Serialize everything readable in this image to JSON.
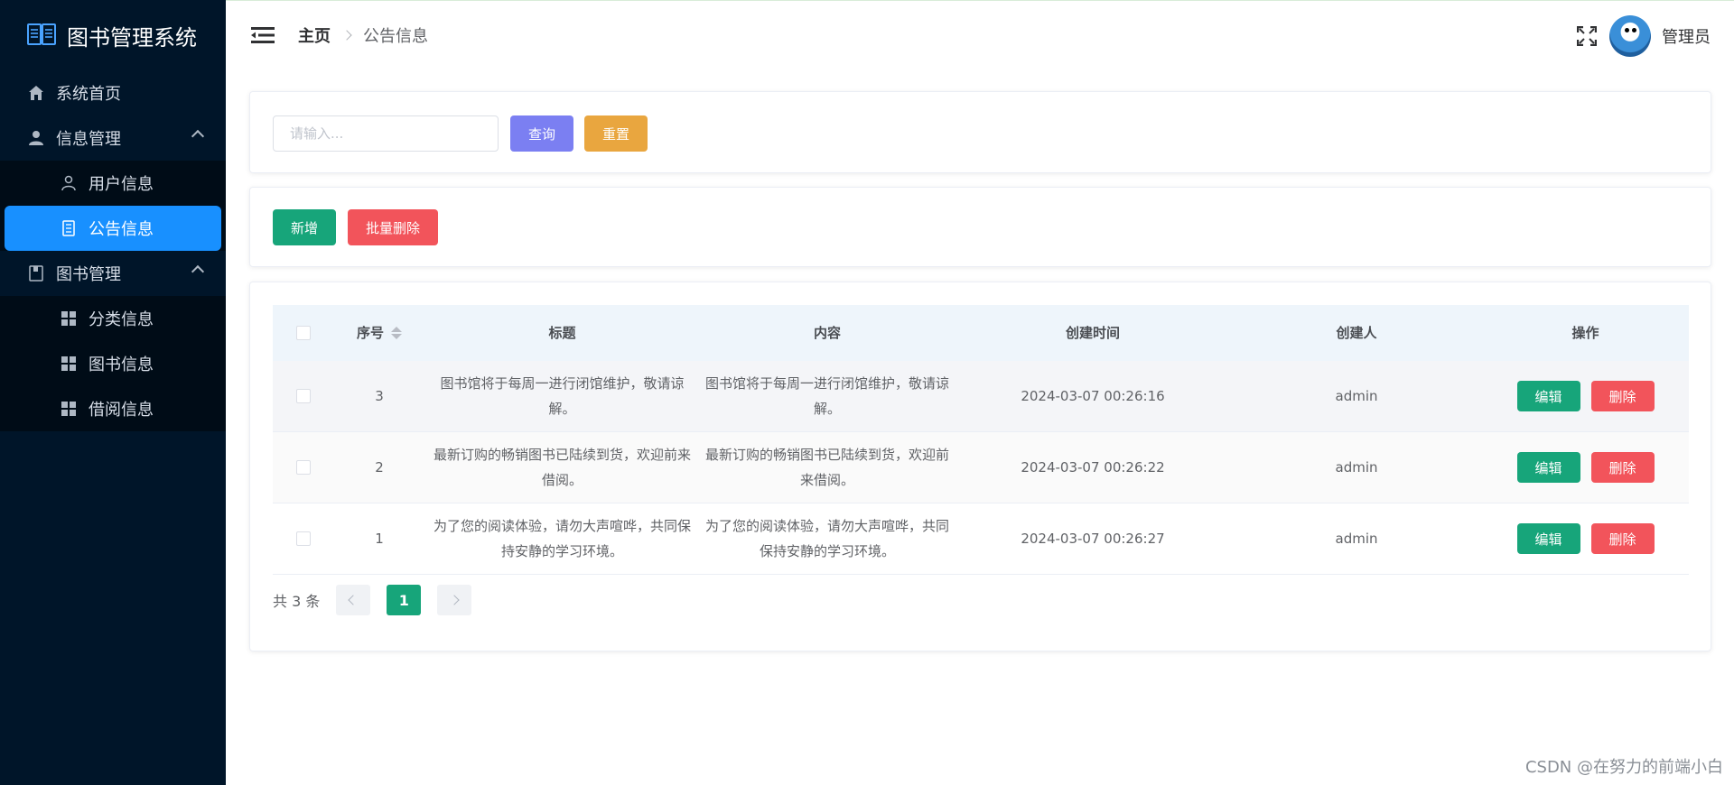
{
  "app": {
    "title": "图书管理系统"
  },
  "sidebar": {
    "items": [
      {
        "label": "系统首页"
      },
      {
        "label": "信息管理"
      },
      {
        "label": "用户信息"
      },
      {
        "label": "公告信息"
      },
      {
        "label": "图书管理"
      },
      {
        "label": "分类信息"
      },
      {
        "label": "图书信息"
      },
      {
        "label": "借阅信息"
      }
    ],
    "active_color": "#1890ff"
  },
  "header": {
    "breadcrumb_home": "主页",
    "breadcrumb_current": "公告信息",
    "username": "管理员"
  },
  "search": {
    "placeholder": "请输入...",
    "value": "",
    "query_label": "查询",
    "reset_label": "重置"
  },
  "toolbar": {
    "add_label": "新增",
    "batch_delete_label": "批量删除"
  },
  "table": {
    "headers": {
      "index": "序号",
      "title": "标题",
      "content": "内容",
      "created_time": "创建时间",
      "creator": "创建人",
      "actions": "操作"
    },
    "rows": [
      {
        "index": "3",
        "title": "图书馆将于每周一进行闭馆维护，敬请谅解。",
        "content": "图书馆将于每周一进行闭馆维护，敬请谅解。",
        "created_time": "2024-03-07 00:26:16",
        "creator": "admin",
        "edit_label": "编辑",
        "delete_label": "删除"
      },
      {
        "index": "2",
        "title": "最新订购的畅销图书已陆续到货，欢迎前来借阅。",
        "content": "最新订购的畅销图书已陆续到货，欢迎前来借阅。",
        "created_time": "2024-03-07 00:26:22",
        "creator": "admin",
        "edit_label": "编辑",
        "delete_label": "删除"
      },
      {
        "index": "1",
        "title": "为了您的阅读体验，请勿大声喧哗，共同保持安静的学习环境。",
        "content": "为了您的阅读体验，请勿大声喧哗，共同保持安静的学习环境。",
        "created_time": "2024-03-07 00:26:27",
        "creator": "admin",
        "edit_label": "编辑",
        "delete_label": "删除"
      }
    ]
  },
  "pagination": {
    "total_text": "共 3 条",
    "current_page": "1"
  },
  "watermark": "CSDN @在努力的前端小白",
  "colors": {
    "sidebar_bg": "#001529",
    "primary_green": "#17a57a",
    "danger_red": "#f2545b",
    "query_purple": "#7b7ff2",
    "reset_orange": "#e9a63f"
  }
}
